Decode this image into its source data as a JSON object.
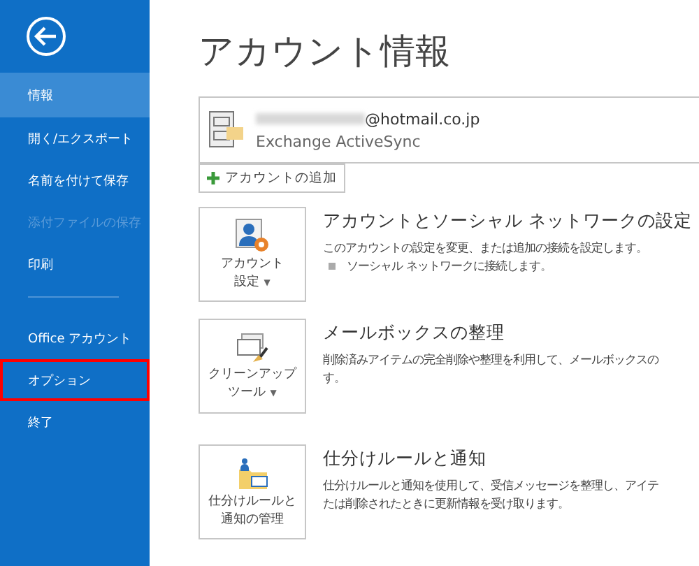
{
  "sidebar": {
    "items": [
      {
        "label": "情報",
        "selected": true,
        "disabled": false,
        "highlighted": false,
        "divider_after": false
      },
      {
        "label": "開く/エクスポート",
        "selected": false,
        "disabled": false,
        "highlighted": false,
        "divider_after": false
      },
      {
        "label": "名前を付けて保存",
        "selected": false,
        "disabled": false,
        "highlighted": false,
        "divider_after": false
      },
      {
        "label": "添付ファイルの保存",
        "selected": false,
        "disabled": true,
        "highlighted": false,
        "divider_after": false
      },
      {
        "label": "印刷",
        "selected": false,
        "disabled": false,
        "highlighted": false,
        "divider_after": true
      },
      {
        "label": "Office アカウント",
        "selected": false,
        "disabled": false,
        "highlighted": false,
        "divider_after": false
      },
      {
        "label": "オプション",
        "selected": false,
        "disabled": false,
        "highlighted": true,
        "divider_after": false
      },
      {
        "label": "終了",
        "selected": false,
        "disabled": false,
        "highlighted": false,
        "divider_after": false
      }
    ]
  },
  "main": {
    "title": "アカウント情報",
    "account": {
      "email": "@hotmail.co.jp",
      "type": "Exchange ActiveSync"
    },
    "add_account": "アカウントの追加",
    "sections": [
      {
        "kind": "account",
        "tile_lines": [
          "アカウント",
          "設定"
        ],
        "tile_caret": "▼",
        "title": "アカウントとソーシャル ネットワークの設定",
        "lines": [
          "このアカウントの設定を変更、または追加の接続を設定します。"
        ],
        "bullets": [
          "ソーシャル ネットワークに接続します。"
        ]
      },
      {
        "kind": "cleanup",
        "tile_lines": [
          "クリーンアップ",
          "ツール"
        ],
        "tile_caret": "▼",
        "title": "メールボックスの整理",
        "lines": [
          "削除済みアイテムの完全削除や整理を利用して、メールボックスの",
          "す。"
        ]
      },
      {
        "kind": "rules",
        "tile_lines": [
          "仕分けルールと",
          "通知の管理"
        ],
        "title": "仕分けルールと通知",
        "lines": [
          "仕分けルールと通知を使用して、受信メッセージを整理し、アイテ",
          "たは削除されたときに更新情報を受け取ります。"
        ]
      }
    ]
  }
}
